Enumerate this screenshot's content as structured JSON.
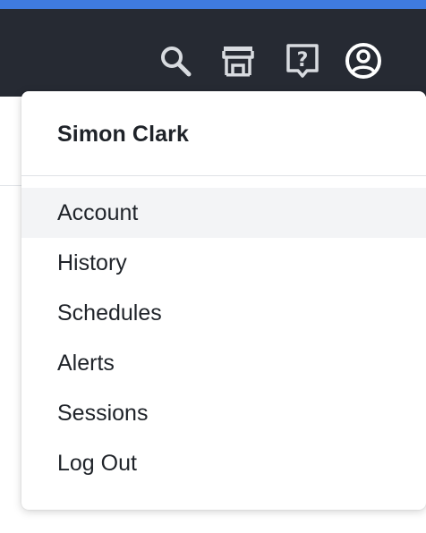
{
  "topbar": {
    "icons": [
      {
        "name": "search-icon"
      },
      {
        "name": "store-icon"
      },
      {
        "name": "help-icon"
      },
      {
        "name": "account-icon"
      }
    ],
    "accent_color": "#3f7be0",
    "background_color": "#262a33"
  },
  "dropdown": {
    "user_name": "Simon Clark",
    "items": [
      {
        "label": "Account",
        "highlighted": true
      },
      {
        "label": "History"
      },
      {
        "label": "Schedules"
      },
      {
        "label": "Alerts"
      },
      {
        "label": "Sessions"
      },
      {
        "label": "Log Out"
      }
    ]
  }
}
